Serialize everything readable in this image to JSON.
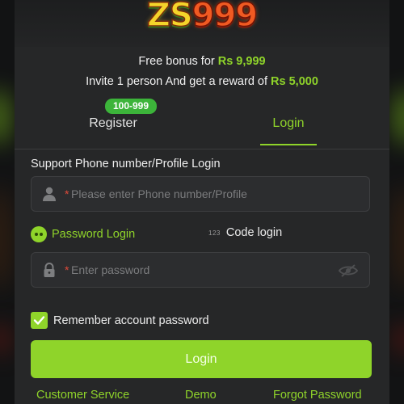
{
  "logo": {
    "part1": "ZS",
    "part2": "999"
  },
  "promo": {
    "line1_prefix": "Free bonus for ",
    "line1_amount": "Rs 9,999",
    "line2_prefix": "Invite 1 person And get a reward of ",
    "line2_amount": "Rs 5,000"
  },
  "tabs": {
    "register_label": "Register",
    "register_badge": "100-999",
    "login_label": "Login",
    "active": "Login"
  },
  "form": {
    "account_label": "Support Phone number/Profile Login",
    "phone_required_mark": "*",
    "phone_placeholder": "Please enter Phone number/Profile",
    "password_mode_label": "Password Login",
    "code_mode_icon": "123",
    "code_mode_label": "Code login",
    "password_required_mark": "*",
    "password_placeholder": "Enter password",
    "remember_label": "Remember account password",
    "remember_checked": true,
    "login_button": "Login"
  },
  "footer": {
    "customer_service": "Customer Service",
    "demo": "Demo",
    "forgot_password": "Forgot Password"
  },
  "icons": {
    "user": "user-icon",
    "lock": "lock-icon",
    "eye": "eye-hidden-icon",
    "password_mode": "password-dots-icon",
    "check": "checkmark-icon"
  },
  "colors": {
    "accent": "#8fd42a",
    "background": "#262728",
    "badge": "#3cb43a",
    "required": "#e04a3a"
  }
}
